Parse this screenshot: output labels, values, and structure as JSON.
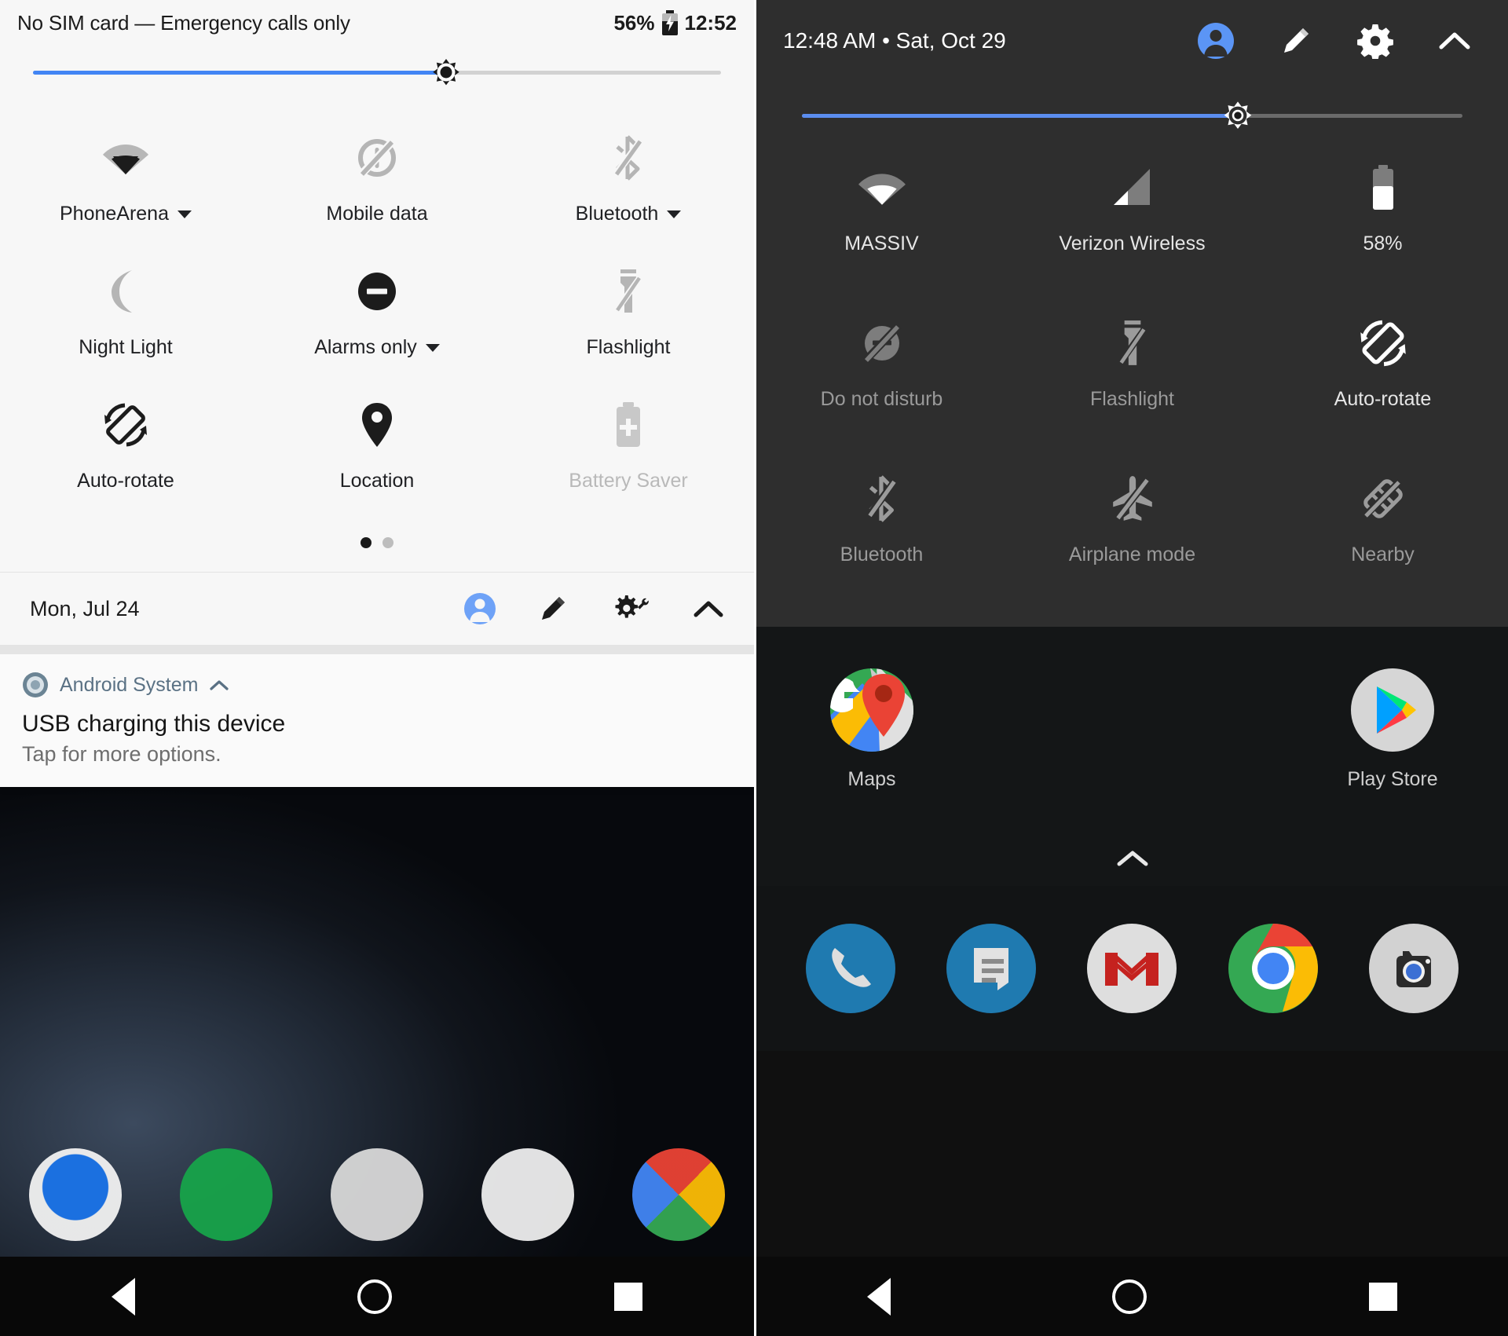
{
  "left": {
    "status_bar": {
      "carrier_text": "No SIM card — Emergency calls only",
      "battery_percent": "56%",
      "battery_icon": "battery-charging-icon",
      "time": "12:52"
    },
    "brightness": {
      "icon": "brightness-icon",
      "value": 60
    },
    "quick_settings": [
      [
        {
          "label": "PhoneArena",
          "icon": "wifi-icon",
          "state": "on",
          "has_caret": true
        },
        {
          "label": "Mobile data",
          "icon": "mobile-data-off-icon",
          "state": "off",
          "has_caret": false
        },
        {
          "label": "Bluetooth",
          "icon": "bluetooth-off-icon",
          "state": "off",
          "has_caret": true
        }
      ],
      [
        {
          "label": "Night Light",
          "icon": "moon-icon",
          "state": "off",
          "has_caret": false
        },
        {
          "label": "Alarms only",
          "icon": "do-not-disturb-icon",
          "state": "on",
          "has_caret": true
        },
        {
          "label": "Flashlight",
          "icon": "flashlight-off-icon",
          "state": "off",
          "has_caret": false
        }
      ],
      [
        {
          "label": "Auto-rotate",
          "icon": "auto-rotate-icon",
          "state": "on",
          "has_caret": false
        },
        {
          "label": "Location",
          "icon": "location-pin-icon",
          "state": "on",
          "has_caret": false
        },
        {
          "label": "Battery Saver",
          "icon": "battery-saver-icon",
          "state": "disabled",
          "has_caret": false
        }
      ]
    ],
    "page_dots": {
      "count": 2,
      "active_index": 0
    },
    "footer": {
      "date": "Mon, Jul 24",
      "icons": [
        "user-avatar-icon",
        "edit-pencil-icon",
        "settings-gear-wrench-icon",
        "collapse-chevron-up-icon"
      ]
    },
    "notification": {
      "app_icon": "android-system-icon",
      "app_name": "Android System",
      "expand_icon": "chevron-up-icon",
      "title": "USB charging this device",
      "subtitle": "Tap for more options."
    },
    "nav_bar": [
      "back-icon",
      "home-icon",
      "recents-icon"
    ]
  },
  "right": {
    "status_bar": {
      "time_date": "12:48 AM • Sat, Oct 29",
      "icons": [
        "user-avatar-icon",
        "edit-pencil-icon",
        "settings-gear-icon",
        "collapse-chevron-up-icon"
      ]
    },
    "brightness": {
      "icon": "brightness-icon",
      "value": 66
    },
    "quick_settings": [
      [
        {
          "label": "MASSIV",
          "icon": "wifi-icon",
          "state": "on"
        },
        {
          "label": "Verizon Wireless",
          "icon": "signal-bars-icon",
          "state": "on"
        },
        {
          "label": "58%",
          "icon": "battery-icon",
          "state": "on"
        }
      ],
      [
        {
          "label": "Do not disturb",
          "icon": "do-not-disturb-off-icon",
          "state": "off"
        },
        {
          "label": "Flashlight",
          "icon": "flashlight-off-icon",
          "state": "off"
        },
        {
          "label": "Auto-rotate",
          "icon": "auto-rotate-icon",
          "state": "on"
        }
      ],
      [
        {
          "label": "Bluetooth",
          "icon": "bluetooth-off-icon",
          "state": "off"
        },
        {
          "label": "Airplane mode",
          "icon": "airplane-off-icon",
          "state": "off"
        },
        {
          "label": "Nearby",
          "icon": "nearby-off-icon",
          "state": "off"
        }
      ]
    ],
    "home_apps": [
      {
        "label": "Maps",
        "icon": "google-maps-icon"
      },
      {
        "label": "Play Store",
        "icon": "google-play-icon"
      }
    ],
    "home_chevron": "app-drawer-chevron-up-icon",
    "dock": [
      "phone-icon",
      "messages-icon",
      "gmail-icon",
      "chrome-icon",
      "camera-icon"
    ],
    "nav_bar": [
      "back-icon",
      "home-icon",
      "recents-icon"
    ]
  },
  "colors": {
    "accent_blue": "#4285f4",
    "light_panel_bg": "#f7f7f7",
    "dark_panel_bg": "#2e2e2e",
    "avatar_blue": "#5b95f5"
  }
}
